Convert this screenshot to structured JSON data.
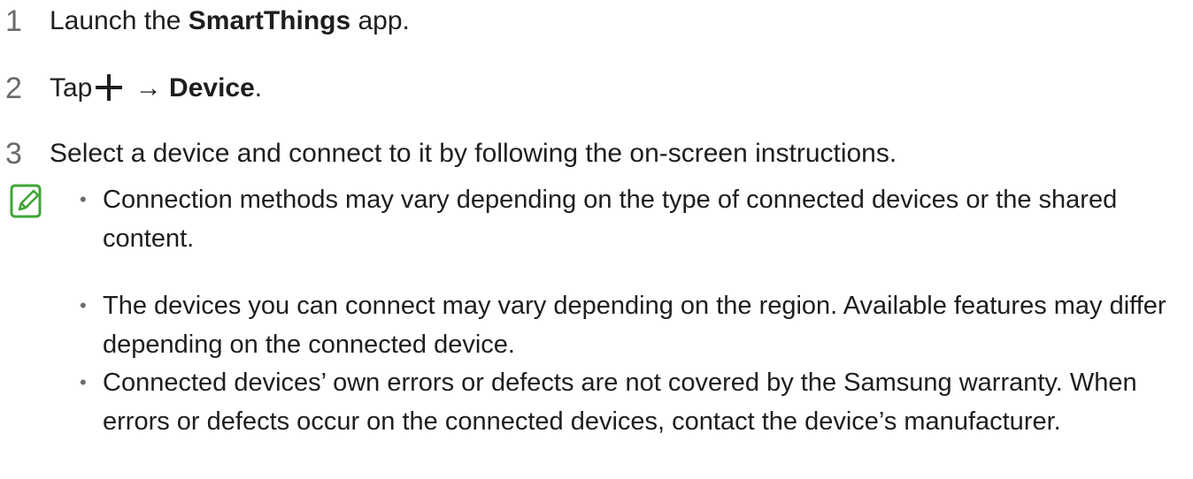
{
  "steps": [
    {
      "num": "1",
      "pre": "Launch the ",
      "bold": "SmartThings",
      "post": " app."
    },
    {
      "num": "2",
      "pre": "Tap",
      "arrow": " → ",
      "bold": "Device",
      "post": "."
    },
    {
      "num": "3",
      "text": "Select a device and connect to it by following the on-screen instructions."
    }
  ],
  "note": {
    "icon": "note-icon",
    "accent": "#3fa535",
    "bullets": [
      "Connection methods may vary depending on the type of connected devices or the shared content.",
      "The devices you can connect may vary depending on the region. Available features may differ depending on the connected device.",
      "Connected devices’ own errors or defects are not covered by the Samsung warranty. When errors or defects occur on the connected devices, contact the device’s manufacturer."
    ]
  }
}
